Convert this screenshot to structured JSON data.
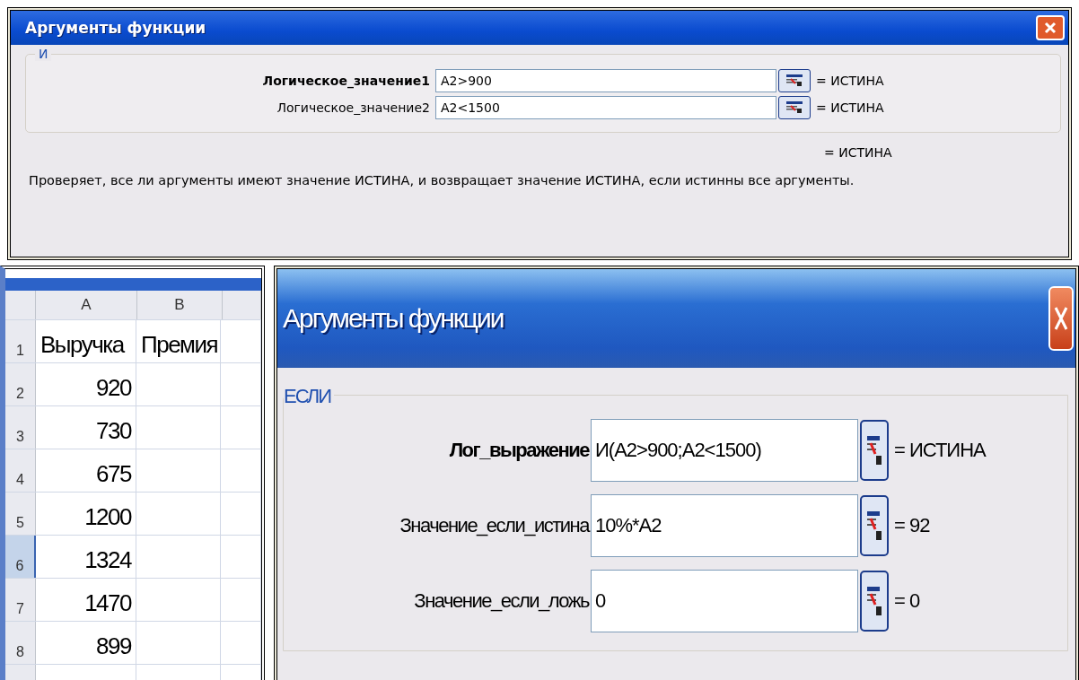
{
  "top_dialog": {
    "title": "Аргументы функции",
    "function_name": "И",
    "arguments": [
      {
        "label": "Логическое_значение1",
        "required": true,
        "value": "A2>900",
        "result": "= ИСТИНА"
      },
      {
        "label": "Логическое_значение2",
        "required": false,
        "value": "A2<1500",
        "result": "= ИСТИНА"
      }
    ],
    "formula_result": "= ИСТИНА",
    "description": "Проверяет, все ли аргументы имеют значение ИСТИНА, и возвращает значение ИСТИНА, если истинны все аргументы."
  },
  "sheet": {
    "columns": [
      "A",
      "B"
    ],
    "rows": [
      {
        "number": "1",
        "selected": false,
        "cells": [
          "Выручка",
          "Премия"
        ]
      },
      {
        "number": "2",
        "selected": false,
        "cells": [
          "920",
          ""
        ]
      },
      {
        "number": "3",
        "selected": false,
        "cells": [
          "730",
          ""
        ]
      },
      {
        "number": "4",
        "selected": false,
        "cells": [
          "675",
          ""
        ]
      },
      {
        "number": "5",
        "selected": false,
        "cells": [
          "1200",
          ""
        ]
      },
      {
        "number": "6",
        "selected": true,
        "cells": [
          "1324",
          ""
        ]
      },
      {
        "number": "7",
        "selected": false,
        "cells": [
          "1470",
          ""
        ]
      },
      {
        "number": "8",
        "selected": false,
        "cells": [
          "899",
          ""
        ]
      }
    ]
  },
  "bottom_dialog": {
    "title": "Аргументы функции",
    "function_name": "ЕСЛИ",
    "arguments": [
      {
        "label": "Лог_выражение",
        "required": true,
        "value": "И(A2>900;A2<1500)",
        "result": "= ИСТИНА"
      },
      {
        "label": "Значение_если_истина",
        "required": false,
        "value": "10%*A2",
        "result": "= 92"
      },
      {
        "label": "Значение_если_ложь",
        "required": false,
        "value": "0",
        "result": "= 0"
      }
    ]
  }
}
